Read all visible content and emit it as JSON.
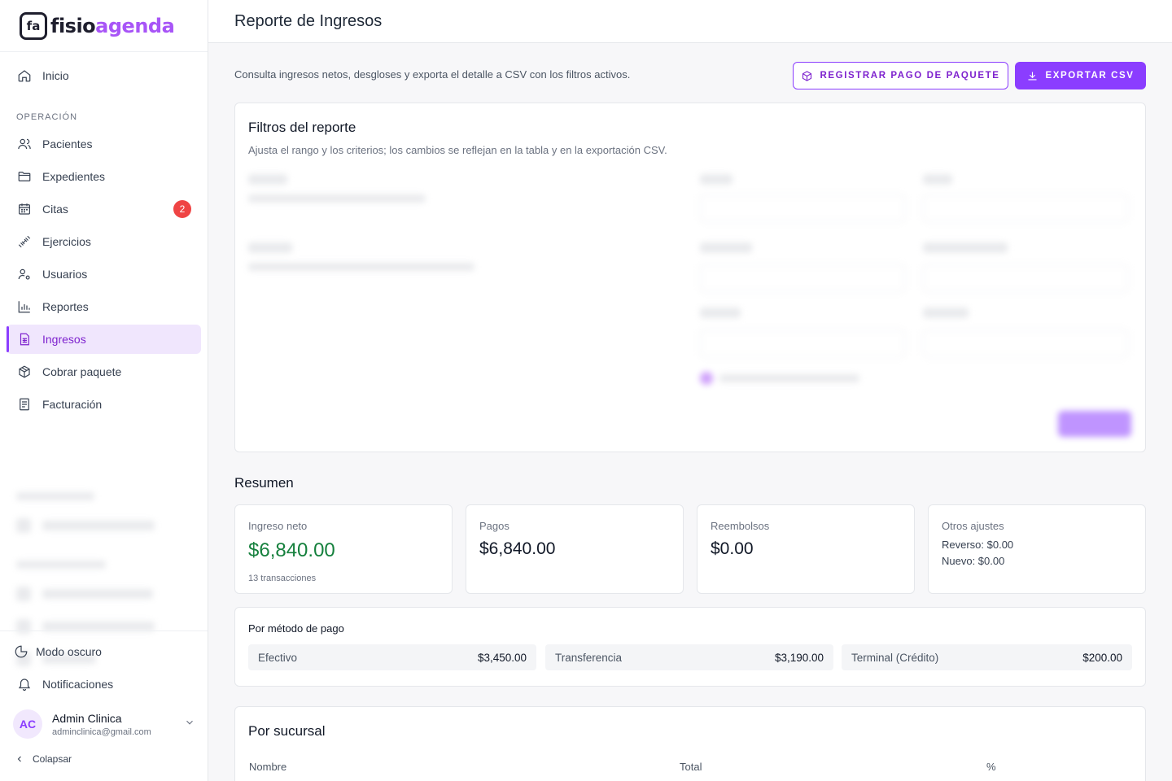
{
  "app": {
    "logo_mark": "fa",
    "logo_text_1": "fisio",
    "logo_text_2": "agenda"
  },
  "sidebar": {
    "home": "Inicio",
    "section_operation": "OPERACIÓN",
    "items": [
      {
        "label": "Pacientes",
        "icon": "users-icon"
      },
      {
        "label": "Expedientes",
        "icon": "folder-icon"
      },
      {
        "label": "Citas",
        "icon": "calendar-icon",
        "badge": "2"
      },
      {
        "label": "Ejercicios",
        "icon": "dumbbell-icon"
      },
      {
        "label": "Usuarios",
        "icon": "user-gear-icon"
      },
      {
        "label": "Reportes",
        "icon": "bar-chart-icon"
      },
      {
        "label": "Ingresos",
        "icon": "spreadsheet-icon",
        "active": true
      },
      {
        "label": "Cobrar paquete",
        "icon": "package-icon"
      },
      {
        "label": "Facturación",
        "icon": "receipt-icon"
      }
    ],
    "dark_mode": "Modo oscuro",
    "notifications": "Notificaciones",
    "user": {
      "initials": "AC",
      "name": "Admin Clinica",
      "email": "adminclinica@gmail.com"
    },
    "collapse": "Colapsar"
  },
  "header": {
    "title": "Reporte de Ingresos",
    "subtitle": "Consulta ingresos netos, desgloses y exporta el detalle a CSV con los filtros activos.",
    "btn_register": "REGISTRAR PAGO DE PAQUETE",
    "btn_export": "EXPORTAR CSV"
  },
  "filters": {
    "title": "Filtros del reporte",
    "description": "Ajusta el rango y los criterios; los cambios se reflejan en la tabla y en la exportación CSV."
  },
  "summary": {
    "title": "Resumen",
    "net": {
      "label": "Ingreso neto",
      "value": "$6,840.00",
      "sub": "13 transacciones"
    },
    "payments": {
      "label": "Pagos",
      "value": "$6,840.00"
    },
    "refunds": {
      "label": "Reembolsos",
      "value": "$0.00"
    },
    "other": {
      "label": "Otros ajustes",
      "line1": "Reverso: $0.00",
      "line2": "Nuevo: $0.00"
    }
  },
  "methods": {
    "title": "Por método de pago",
    "items": [
      {
        "name": "Efectivo",
        "value": "$3,450.00"
      },
      {
        "name": "Transferencia",
        "value": "$3,190.00"
      },
      {
        "name": "Terminal (Crédito)",
        "value": "$200.00"
      }
    ]
  },
  "branches": {
    "title": "Por sucursal",
    "columns": [
      "Nombre",
      "Total",
      "%"
    ]
  },
  "colors": {
    "accent": "#8b3dff",
    "green": "#15803d",
    "badge": "#ef4444"
  }
}
